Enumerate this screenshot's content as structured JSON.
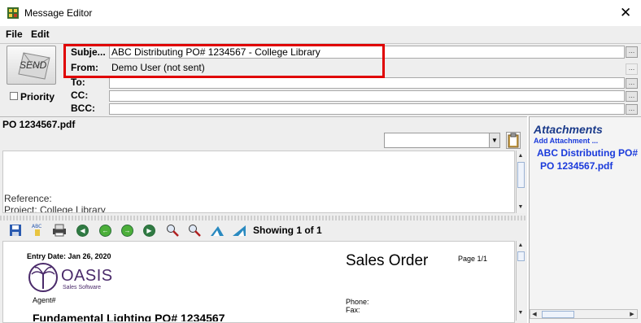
{
  "window": {
    "title": "Message Editor",
    "close_glyph": "✕",
    "icon": "app-icon"
  },
  "menu": {
    "items": [
      "File",
      "Edit"
    ]
  },
  "header": {
    "send_label": "SEND",
    "priority_label": "Priority",
    "subject_label": "Subje...",
    "subject_value": "ABC Distributing PO# 1234567 - College Library",
    "from_label": "From:",
    "from_value": "Demo User (not sent)",
    "to_label": "To:",
    "to_value": "",
    "cc_label": "CC:",
    "cc_value": "",
    "bcc_label": "BCC:",
    "bcc_value": "",
    "dots": "..."
  },
  "viewer": {
    "file_name": "PO 1234567.pdf",
    "reference_label": "Reference:",
    "project_line": "Project: College Library",
    "showing": "Showing 1 of 1"
  },
  "document": {
    "entry_date": "Entry Date: Jan 26, 2020",
    "logo_text": "OASIS",
    "logo_sub": "Sales Software",
    "agent": "Agent#",
    "title": "Sales Order",
    "page": "Page 1/1",
    "phone": "Phone:",
    "fax": "Fax:",
    "company_line": "Fundamental Lighting PO# 1234567"
  },
  "attachments": {
    "title": "Attachments",
    "add_link": "Add Attachment ...",
    "file_line1": "ABC Distributing PO#",
    "file_line2": "PO 1234567.pdf"
  },
  "colors": {
    "highlight_box": "#e00000",
    "link_blue": "#1a3adb",
    "panel_bg": "#eeeeee"
  }
}
